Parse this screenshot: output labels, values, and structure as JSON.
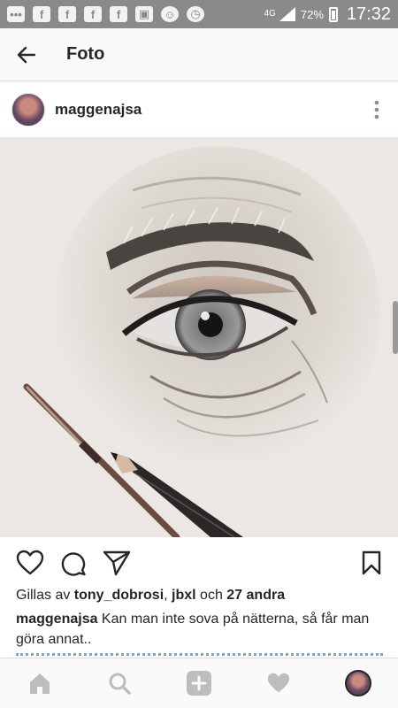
{
  "status_bar": {
    "icons_left": [
      "message-icon",
      "facebook-icon",
      "facebook-icon",
      "facebook-icon",
      "facebook-icon",
      "gallery-icon",
      "accessibility-icon",
      "alarm-icon"
    ],
    "network": "4G",
    "battery": "72%",
    "time": "17:32"
  },
  "app_bar": {
    "title": "Foto",
    "back_icon": "arrow-left-icon"
  },
  "post": {
    "username": "maggenajsa",
    "liked_prefix": "Gillas av ",
    "liked_user1": "tony_dobrosi",
    "liked_sep": ", ",
    "liked_user2": "jbxl",
    "liked_and": " och ",
    "liked_others": "27 andra",
    "caption_user": "maggenajsa",
    "caption_text": " Kan man inte sova på nätterna, så får man göra annat.."
  },
  "actions": [
    "heart-icon",
    "comment-icon",
    "share-icon",
    "bookmark-icon"
  ],
  "bottom_nav": [
    "home-icon",
    "search-icon",
    "add-icon",
    "activity-heart-icon",
    "profile-avatar"
  ],
  "colors": {
    "status_bar": "#8a8a8a",
    "text": "#262626",
    "hashtag": "#7aa6c9",
    "divider": "#dbdbdb"
  }
}
